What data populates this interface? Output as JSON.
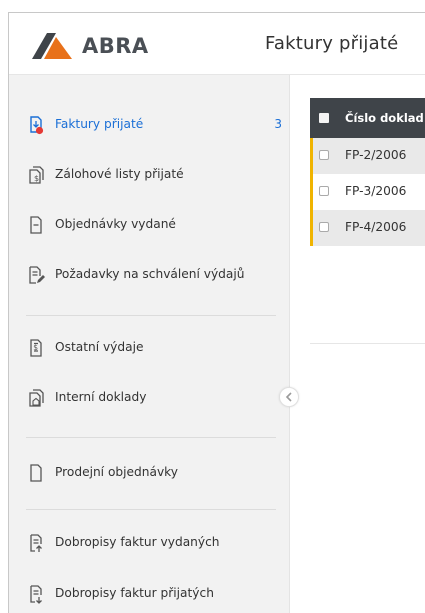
{
  "app": {
    "logo_text": "ABRA",
    "page_title": "Faktury přijaté"
  },
  "colors": {
    "accent": "#1b6fd6",
    "row_marker": "#f0b400",
    "header_bg": "#3f4449",
    "logo_orange": "#e8711a",
    "badge_red": "#e53935"
  },
  "sidebar": {
    "items": [
      {
        "label": "Faktury přijaté",
        "count": "3",
        "icon": "received-invoice-icon"
      },
      {
        "label": "Zálohové listy přijaté",
        "icon": "advance-invoice-icon"
      },
      {
        "label": "Objednávky vydané",
        "icon": "purchase-order-icon"
      },
      {
        "label": "Požadavky na schválení výdajů",
        "icon": "expense-approval-icon"
      },
      {
        "label": "Ostatní výdaje",
        "icon": "other-expenses-icon"
      },
      {
        "label": "Interní doklady",
        "icon": "internal-document-icon"
      },
      {
        "label": "Prodejní objednávky",
        "icon": "sales-order-icon"
      },
      {
        "label": "Dobropisy faktur vydaných",
        "icon": "issued-credit-note-icon"
      },
      {
        "label": "Dobropisy faktur přijatých",
        "icon": "received-credit-note-icon"
      }
    ]
  },
  "table": {
    "columns": [
      "Číslo doklad"
    ],
    "rows": [
      {
        "number": "FP-2/2006"
      },
      {
        "number": "FP-3/2006"
      },
      {
        "number": "FP-4/2006"
      }
    ]
  }
}
